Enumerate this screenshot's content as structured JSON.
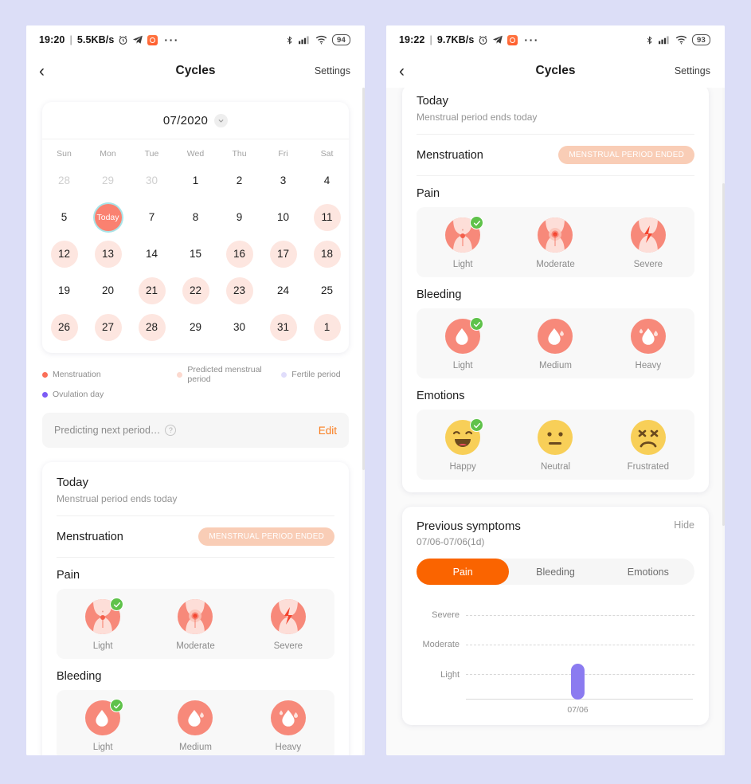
{
  "theme": {
    "page_bg": "#dcdef7",
    "accent_orange": "#fa6400",
    "coral": "#fa8170",
    "pale_pink": "#fde6e0",
    "purple": "#8b7bf0",
    "green_check": "#5fc24a",
    "badge_bg": "#f9cdb6"
  },
  "left": {
    "status": {
      "time": "19:20",
      "separator": "|",
      "net_speed": "5.5KB/s",
      "alarm_icon": "alarm-clock-icon",
      "telegram_icon": "telegram-icon",
      "app_icon": "app-icon",
      "overflow": "···",
      "bluetooth_icon": "bluetooth-icon",
      "signal_icon": "cellular-signal-icon",
      "wifi_icon": "wifi-icon",
      "battery": "94"
    },
    "nav": {
      "back_icon": "chevron-left-icon",
      "title": "Cycles",
      "settings": "Settings"
    },
    "calendar": {
      "month": "07/2020",
      "chevron_icon": "chevron-down-icon",
      "weekdays": [
        "Sun",
        "Mon",
        "Tue",
        "Wed",
        "Thu",
        "Fri",
        "Sat"
      ],
      "weeks": [
        [
          {
            "n": "28",
            "state": "out"
          },
          {
            "n": "29",
            "state": "out"
          },
          {
            "n": "30",
            "state": "out"
          },
          {
            "n": "1",
            "state": "normal"
          },
          {
            "n": "2",
            "state": "normal"
          },
          {
            "n": "3",
            "state": "normal"
          },
          {
            "n": "4",
            "state": "normal"
          }
        ],
        [
          {
            "n": "5",
            "state": "normal"
          },
          {
            "n": "Today",
            "state": "today"
          },
          {
            "n": "7",
            "state": "normal"
          },
          {
            "n": "8",
            "state": "normal"
          },
          {
            "n": "9",
            "state": "normal"
          },
          {
            "n": "10",
            "state": "normal"
          },
          {
            "n": "11",
            "state": "pred"
          }
        ],
        [
          {
            "n": "12",
            "state": "pred"
          },
          {
            "n": "13",
            "state": "pred"
          },
          {
            "n": "14",
            "state": "normal"
          },
          {
            "n": "15",
            "state": "normal"
          },
          {
            "n": "16",
            "state": "pred"
          },
          {
            "n": "17",
            "state": "pred"
          },
          {
            "n": "18",
            "state": "pred"
          }
        ],
        [
          {
            "n": "19",
            "state": "normal"
          },
          {
            "n": "20",
            "state": "normal"
          },
          {
            "n": "21",
            "state": "pred"
          },
          {
            "n": "22",
            "state": "pred"
          },
          {
            "n": "23",
            "state": "pred"
          },
          {
            "n": "24",
            "state": "normal"
          },
          {
            "n": "25",
            "state": "normal"
          }
        ],
        [
          {
            "n": "26",
            "state": "pred"
          },
          {
            "n": "27",
            "state": "pred"
          },
          {
            "n": "28",
            "state": "pred"
          },
          {
            "n": "29",
            "state": "normal"
          },
          {
            "n": "30",
            "state": "normal"
          },
          {
            "n": "31",
            "state": "pred"
          },
          {
            "n": "1",
            "state": "pred"
          }
        ]
      ],
      "legend": [
        {
          "label": "Menstruation",
          "color": "#fa6f58"
        },
        {
          "label": "Predicted menstrual period",
          "color": "#fcd9cf"
        },
        {
          "label": "Fertile period",
          "color": "#e0ddfb"
        },
        {
          "label": "Ovulation day",
          "color": "#7c5cf5"
        }
      ],
      "predict_text": "Predicting next period…",
      "help_icon": "question-mark-icon",
      "edit_label": "Edit"
    },
    "today_card": {
      "title": "Today",
      "subtitle": "Menstrual period ends today",
      "menstruation_label": "Menstruation",
      "menstruation_badge": "MENSTRUAL PERIOD ENDED",
      "pain_title": "Pain",
      "pain_options": [
        {
          "label": "Light",
          "icon": "pain-light-icon",
          "selected": true
        },
        {
          "label": "Moderate",
          "icon": "pain-moderate-icon",
          "selected": false
        },
        {
          "label": "Severe",
          "icon": "pain-severe-icon",
          "selected": false
        }
      ],
      "bleeding_title": "Bleeding",
      "bleeding_options": [
        {
          "label": "Light",
          "icon": "blood-drop-light-icon",
          "selected": true
        },
        {
          "label": "Medium",
          "icon": "blood-drop-medium-icon",
          "selected": false
        },
        {
          "label": "Heavy",
          "icon": "blood-drop-heavy-icon",
          "selected": false
        }
      ]
    }
  },
  "right": {
    "status": {
      "time": "19:22",
      "separator": "|",
      "net_speed": "9.7KB/s",
      "alarm_icon": "alarm-clock-icon",
      "telegram_icon": "telegram-icon",
      "app_icon": "app-icon",
      "overflow": "···",
      "bluetooth_icon": "bluetooth-icon",
      "signal_icon": "cellular-signal-icon",
      "wifi_icon": "wifi-icon",
      "battery": "93"
    },
    "nav": {
      "back_icon": "chevron-left-icon",
      "title": "Cycles",
      "settings": "Settings"
    },
    "today_card": {
      "title": "Today",
      "subtitle": "Menstrual period ends today",
      "menstruation_label": "Menstruation",
      "menstruation_badge": "MENSTRUAL PERIOD ENDED",
      "pain_title": "Pain",
      "pain_options": [
        {
          "label": "Light",
          "icon": "pain-light-icon",
          "selected": true
        },
        {
          "label": "Moderate",
          "icon": "pain-moderate-icon",
          "selected": false
        },
        {
          "label": "Severe",
          "icon": "pain-severe-icon",
          "selected": false
        }
      ],
      "bleeding_title": "Bleeding",
      "bleeding_options": [
        {
          "label": "Light",
          "icon": "blood-drop-light-icon",
          "selected": true
        },
        {
          "label": "Medium",
          "icon": "blood-drop-medium-icon",
          "selected": false
        },
        {
          "label": "Heavy",
          "icon": "blood-drop-heavy-icon",
          "selected": false
        }
      ],
      "emotions_title": "Emotions",
      "emotion_options": [
        {
          "label": "Happy",
          "icon": "emoji-happy-icon",
          "selected": true
        },
        {
          "label": "Neutral",
          "icon": "emoji-neutral-icon",
          "selected": false
        },
        {
          "label": "Frustrated",
          "icon": "emoji-frustrated-icon",
          "selected": false
        }
      ]
    },
    "previous": {
      "title": "Previous symptoms",
      "range": "07/06-07/06(1d)",
      "hide_label": "Hide",
      "tabs": [
        {
          "label": "Pain",
          "active": true
        },
        {
          "label": "Bleeding",
          "active": false
        },
        {
          "label": "Emotions",
          "active": false
        }
      ]
    }
  },
  "chart_data": {
    "type": "bar",
    "title": "Previous symptoms",
    "subtitle": "07/06-07/06(1d)",
    "active_series": "Pain",
    "categories": [
      "07/06"
    ],
    "x": [
      "07/06"
    ],
    "values": [
      1
    ],
    "value_labels": [
      "Light"
    ],
    "ytick_labels": [
      "Light",
      "Moderate",
      "Severe"
    ],
    "ytick_values": [
      1,
      2,
      3
    ],
    "ylim": [
      0,
      3
    ],
    "xlabel": "",
    "ylabel": "",
    "grid": true,
    "grid_style": "dashed-horizontal",
    "legend": false,
    "bar_color": "#8b7bf0",
    "series": [
      {
        "name": "Pain",
        "values": [
          1
        ]
      }
    ]
  }
}
